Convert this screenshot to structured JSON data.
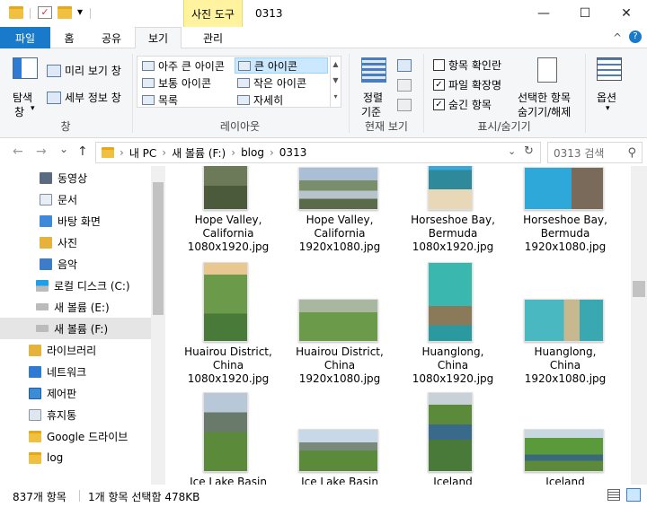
{
  "titlebar": {
    "context_tab": "사진 도구",
    "title": "0313",
    "minimize": "—",
    "maximize": "☐",
    "close": "✕",
    "dropdown": "▾"
  },
  "tabs": [
    "파일",
    "홈",
    "공유",
    "보기",
    "관리"
  ],
  "ribbon": {
    "nav_pane": {
      "label1": "탐색",
      "label2": "창",
      "arrow": "▾"
    },
    "preview_pane": "미리 보기 창",
    "details_pane": "세부 정보 창",
    "panes_group": "창",
    "layout": {
      "items": [
        "아주 큰 아이콘",
        "큰 아이콘",
        "보통 아이콘",
        "작은 아이콘",
        "목록",
        "자세히"
      ],
      "selected": "큰 아이콘",
      "group": "레이아웃"
    },
    "sort": {
      "label1": "정렬",
      "label2": "기준"
    },
    "current_view_group": "현재 보기",
    "checkboxes": [
      {
        "label": "항목 확인란",
        "checked": false
      },
      {
        "label": "파일 확장명",
        "checked": true
      },
      {
        "label": "숨긴 항목",
        "checked": true
      }
    ],
    "hide_selected": {
      "label1": "선택한 항목",
      "label2": "숨기기/해제"
    },
    "show_hide_group": "표시/숨기기",
    "options": "옵션",
    "help": "?",
    "collapse": "^"
  },
  "nav": {
    "back": "←",
    "forward": "→",
    "recent": "⌄",
    "up": "↑",
    "breadcrumb": [
      "내 PC",
      "새 볼륨 (F:)",
      "blog",
      "0313"
    ],
    "sep": "›",
    "refresh": "↻",
    "search_placeholder": "0313 검색",
    "search_icon": "⚲"
  },
  "sidebar": {
    "items": [
      {
        "label": "동영상",
        "icon": "video-folder-icon"
      },
      {
        "label": "문서",
        "icon": "documents-folder-icon"
      },
      {
        "label": "바탕 화면",
        "icon": "desktop-folder-icon"
      },
      {
        "label": "사진",
        "icon": "pictures-folder-icon"
      },
      {
        "label": "음악",
        "icon": "music-folder-icon"
      },
      {
        "label": "로컬 디스크 (C:)",
        "icon": "windows-drive-icon"
      },
      {
        "label": "새 볼륨 (E:)",
        "icon": "drive-icon"
      },
      {
        "label": "새 볼륨 (F:)",
        "icon": "drive-icon"
      },
      {
        "label": "라이브러리",
        "icon": "library-icon"
      },
      {
        "label": "네트워크",
        "icon": "network-icon"
      },
      {
        "label": "제어판",
        "icon": "control-panel-icon"
      },
      {
        "label": "휴지통",
        "icon": "recycle-bin-icon"
      },
      {
        "label": "Google 드라이브",
        "icon": "folder-icon"
      },
      {
        "label": "log",
        "icon": "folder-icon"
      }
    ],
    "selected": "새 볼륨 (F:)"
  },
  "files": [
    {
      "l1": "Hope Valley,",
      "l2": "California",
      "l3": "1080x1920.jpg",
      "orient": "portrait"
    },
    {
      "l1": "Hope Valley,",
      "l2": "California",
      "l3": "1920x1080.jpg",
      "orient": "landscape"
    },
    {
      "l1": "Horseshoe Bay,",
      "l2": "Bermuda",
      "l3": "1080x1920.jpg",
      "orient": "portrait"
    },
    {
      "l1": "Horseshoe Bay,",
      "l2": "Bermuda",
      "l3": "1920x1080.jpg",
      "orient": "landscape"
    },
    {
      "l1": "Huairou District,",
      "l2": "China",
      "l3": "1080x1920.jpg",
      "orient": "portrait"
    },
    {
      "l1": "Huairou District,",
      "l2": "China",
      "l3": "1920x1080.jpg",
      "orient": "landscape"
    },
    {
      "l1": "Huanglong,",
      "l2": "China",
      "l3": "1080x1920.jpg",
      "orient": "portrait"
    },
    {
      "l1": "Huanglong,",
      "l2": "China",
      "l3": "1920x1080.jpg",
      "orient": "landscape"
    },
    {
      "l1": "Ice Lake Basin",
      "l2": "",
      "l3": "",
      "orient": "portrait"
    },
    {
      "l1": "Ice Lake Basin",
      "l2": "",
      "l3": "",
      "orient": "landscape"
    },
    {
      "l1": "Iceland",
      "l2": "",
      "l3": "",
      "orient": "portrait"
    },
    {
      "l1": "Iceland",
      "l2": "",
      "l3": "",
      "orient": "landscape"
    }
  ],
  "status": {
    "count": "837개 항목",
    "selection": "1개 항목 선택함 478KB"
  },
  "colors": {
    "accent": "#1979ca",
    "context_tab": "#fff3a0",
    "selection": "#cce8ff"
  }
}
